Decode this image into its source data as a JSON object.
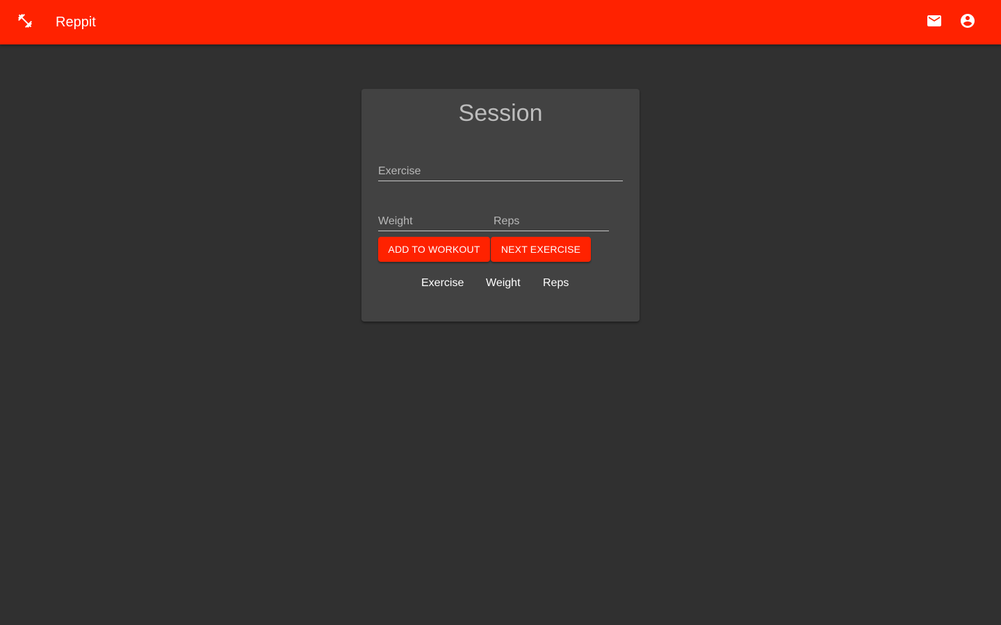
{
  "appbar": {
    "title": "Reppit",
    "menu_icon": "fitness-icon",
    "mail_icon": "mail-icon",
    "account_icon": "account-circle-icon",
    "color": "#ff2200"
  },
  "session": {
    "title": "Session",
    "exercise_placeholder": "Exercise",
    "weight_placeholder": "Weight",
    "reps_placeholder": "Reps",
    "add_button": "ADD TO WORKOUT",
    "next_button": "NEXT EXERCISE",
    "table_headers": [
      "Exercise",
      "Weight",
      "Reps"
    ]
  },
  "colors": {
    "background": "#303030",
    "card": "#424242",
    "accent": "#ff2200"
  }
}
